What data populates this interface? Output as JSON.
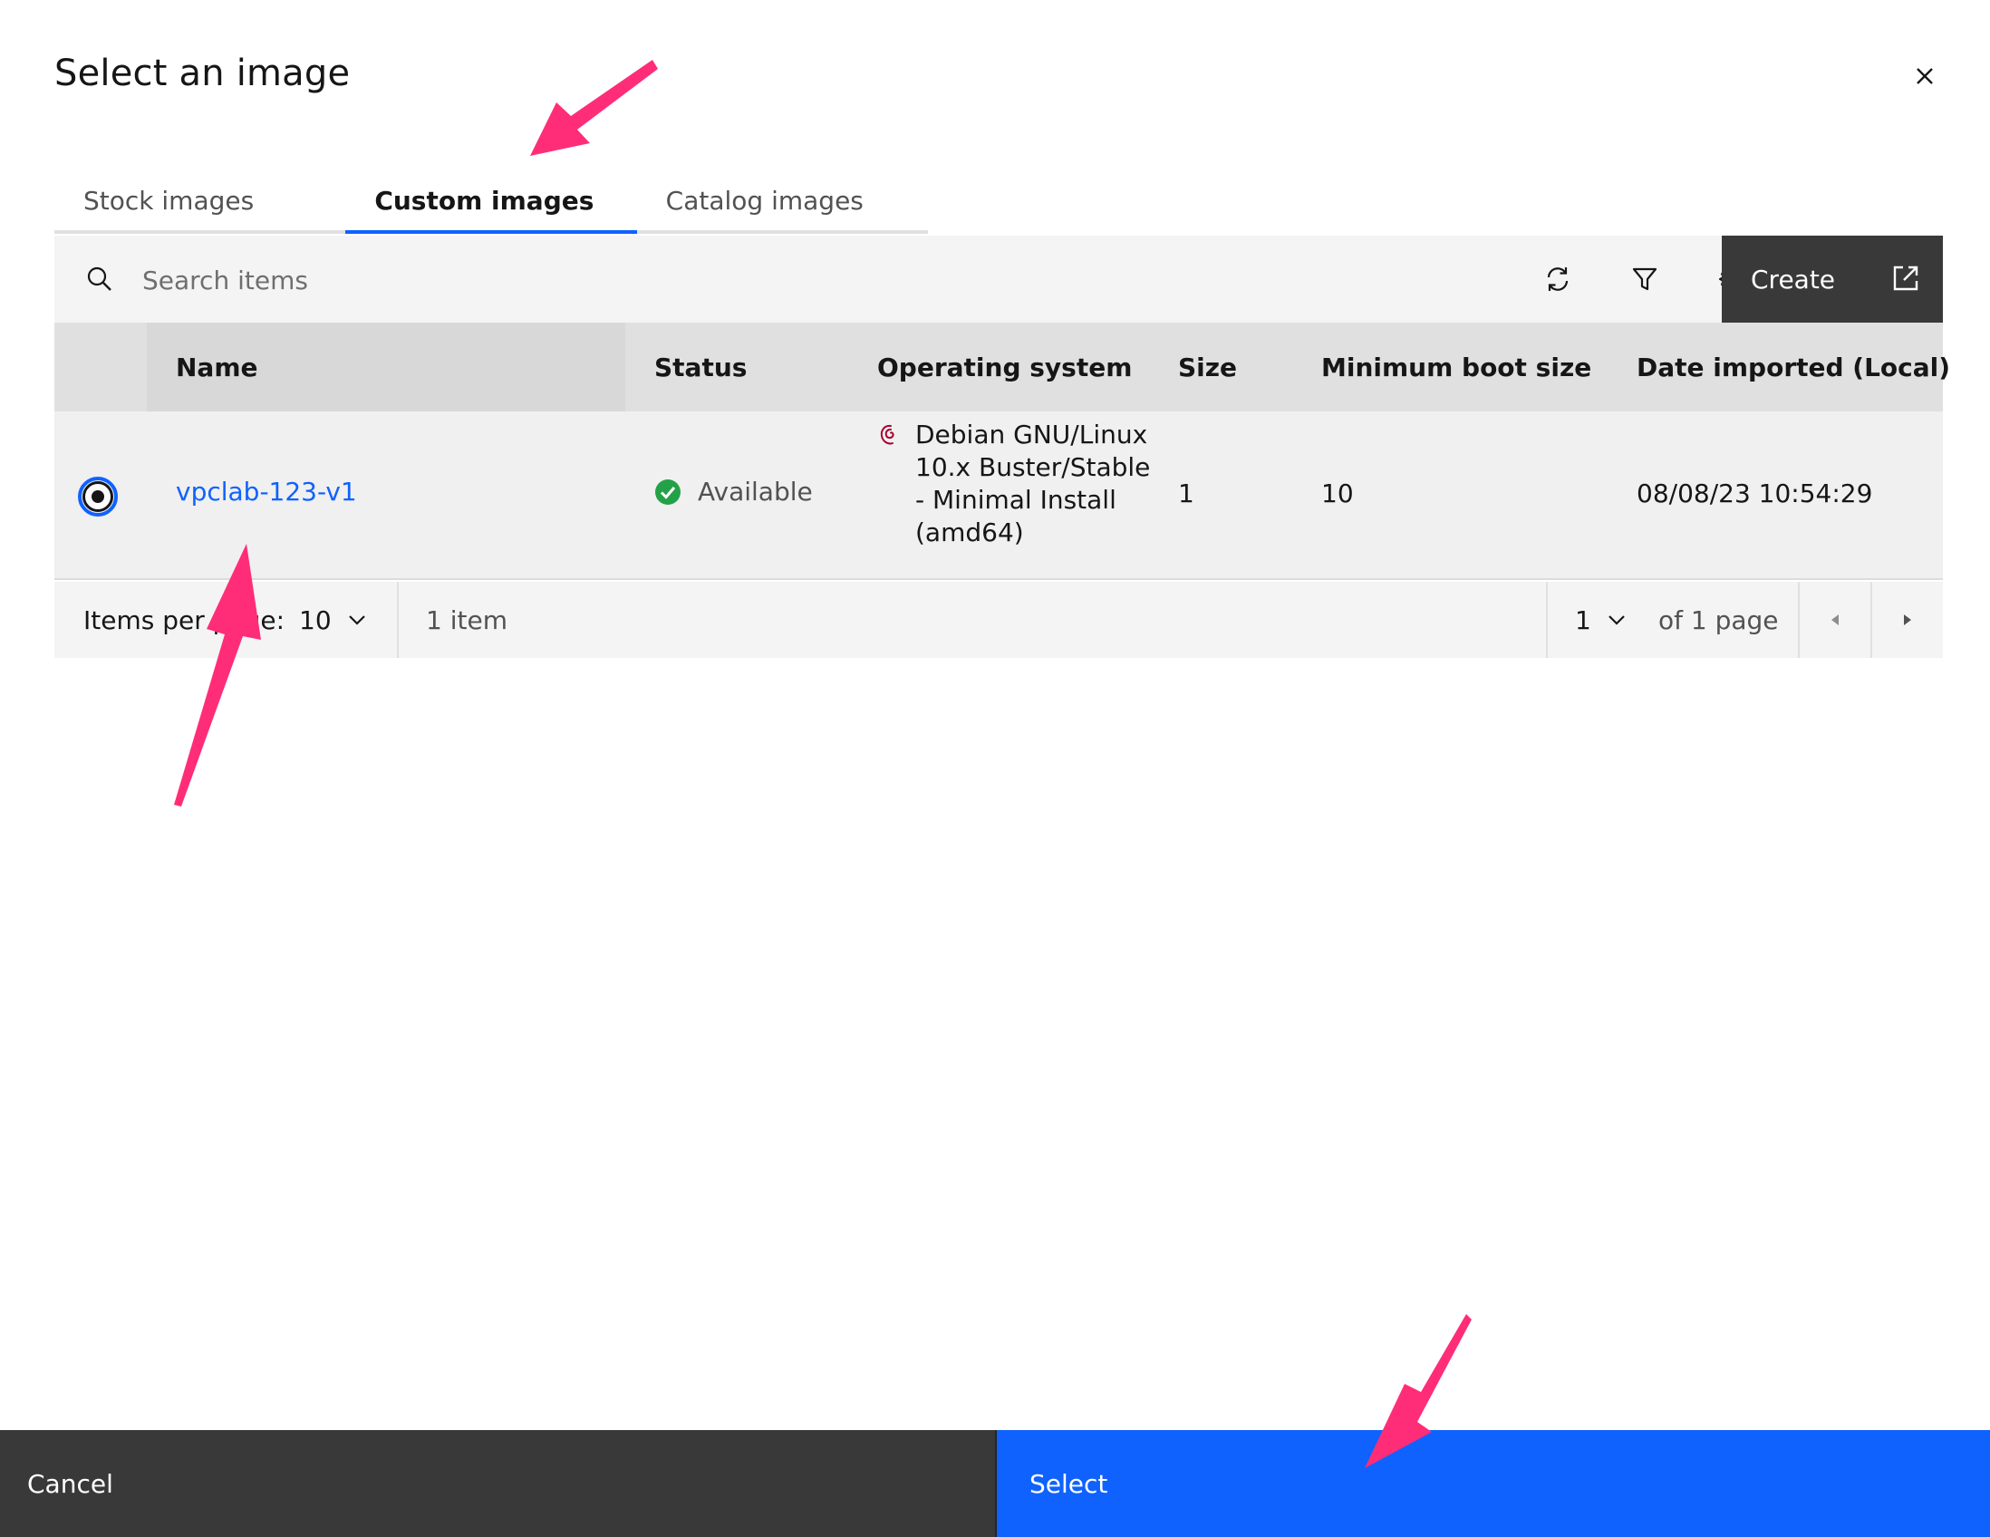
{
  "dialog": {
    "title": "Select an image",
    "close_icon": "close-icon"
  },
  "tabs": [
    {
      "label": "Stock images",
      "active": false
    },
    {
      "label": "Custom images",
      "active": true
    },
    {
      "label": "Catalog images",
      "active": false
    }
  ],
  "toolbar": {
    "search_placeholder": "Search items",
    "search_icon": "search-icon",
    "refresh_icon": "refresh-icon",
    "filter_icon": "filter-icon",
    "settings_icon": "gear-icon",
    "create_label": "Create",
    "create_icon": "external-link-icon"
  },
  "table": {
    "columns": [
      "Name",
      "Status",
      "Operating system",
      "Size",
      "Minimum boot size",
      "Date imported (Local)"
    ],
    "rows": [
      {
        "selected": true,
        "name": "vpclab-123-v1",
        "status": "Available",
        "status_icon": "checkmark-filled-icon",
        "os_icon": "debian-icon",
        "os": "Debian GNU/Linux 10.x Buster/Stable - Minimal Install (amd64)",
        "size": "1",
        "min_boot_size": "10",
        "date_imported": "08/08/23 10:54:29"
      }
    ]
  },
  "pagination": {
    "items_per_page_label": "Items per page:",
    "items_per_page_value": "10",
    "item_count": "1 item",
    "page_value": "1",
    "page_total": "of 1 page",
    "prev_icon": "caret-left-icon",
    "next_icon": "caret-right-icon"
  },
  "footer": {
    "cancel_label": "Cancel",
    "select_label": "Select"
  },
  "colors": {
    "primary": "#0f62fe",
    "dark_button": "#393939",
    "success": "#24a148",
    "annotation_arrow": "#ff2d78"
  }
}
